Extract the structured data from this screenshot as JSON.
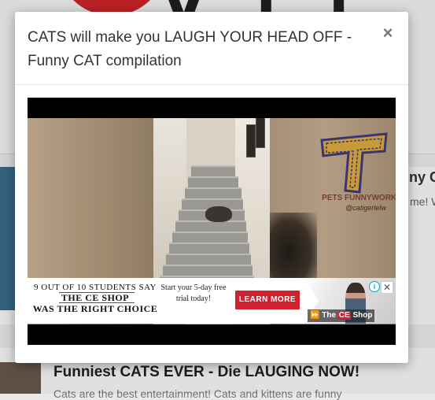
{
  "modal": {
    "title": "CATS will make you LAUGH YOUR HEAD OFF - Funny CAT compilation",
    "close_label": "×"
  },
  "video": {
    "watermark_text": "PETS FUNNYWORKS",
    "watermark_sub": "@catigerlelw"
  },
  "ad": {
    "line1": "9 OUT OF 10 STUDENTS SAY",
    "line2": "THE CE SHOP",
    "line3": "WAS THE RIGHT CHOICE",
    "mid_text": "Start your 5-day free trial today!",
    "button_label": "LEARN MORE",
    "brand_prefix": "The ",
    "brand_ce": "CE",
    "brand_suffix": " Shop",
    "info_label": "i",
    "close_label": "✕"
  },
  "background": {
    "logo_text": "V f l",
    "card_title": "ny C",
    "card_sub": "me! W",
    "row2_title": "Funniest CATS EVER - Die LAUGING NOW!",
    "row2_sub": "Cats are the best entertainment! Cats and kittens are funny"
  },
  "colors": {
    "accent_red": "#d0212e",
    "logo_red": "#d1262b",
    "ad_info_blue": "#00aecd"
  }
}
